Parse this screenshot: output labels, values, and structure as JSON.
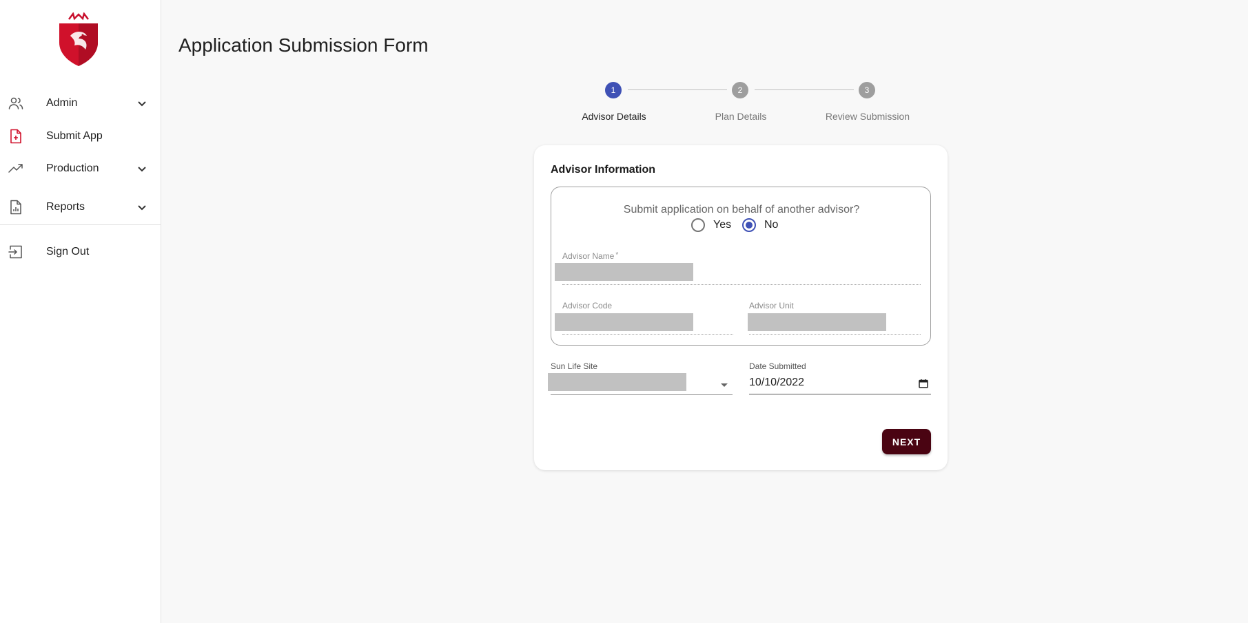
{
  "sidebar": {
    "items": [
      {
        "label": "Admin",
        "icon": "users-icon",
        "has_submenu": true
      },
      {
        "label": "Submit App",
        "icon": "file-plus-icon",
        "has_submenu": false
      },
      {
        "label": "Production",
        "icon": "trending-up-icon",
        "has_submenu": true
      },
      {
        "label": "Reports",
        "icon": "report-file-icon",
        "has_submenu": true
      },
      {
        "label": "Sign Out",
        "icon": "sign-out-icon",
        "has_submenu": false
      }
    ]
  },
  "main": {
    "title": "Application Submission Form",
    "stepper": {
      "steps": [
        {
          "number": "1",
          "label": "Advisor Details",
          "active": true
        },
        {
          "number": "2",
          "label": "Plan Details",
          "active": false
        },
        {
          "number": "3",
          "label": "Review Submission",
          "active": false
        }
      ]
    },
    "card": {
      "title": "Advisor Information",
      "question": "Submit application on behalf of another advisor?",
      "radio": {
        "yes_label": "Yes",
        "no_label": "No",
        "selected": "No"
      },
      "advisor_name": {
        "label": "Advisor Name",
        "required_mark": "*",
        "value": ""
      },
      "advisor_code": {
        "label": "Advisor Code",
        "value": ""
      },
      "advisor_unit": {
        "label": "Advisor Unit",
        "value": ""
      },
      "sun_life_site": {
        "label": "Sun Life Site",
        "value": ""
      },
      "date_submitted": {
        "label": "Date Submitted",
        "value": "10/10/2022"
      },
      "next_label": "NEXT"
    }
  },
  "colors": {
    "accent": "#3f51b5",
    "brand_red": "#d0112b",
    "next_button": "#4a0412",
    "inactive_step": "#9e9e9e"
  }
}
